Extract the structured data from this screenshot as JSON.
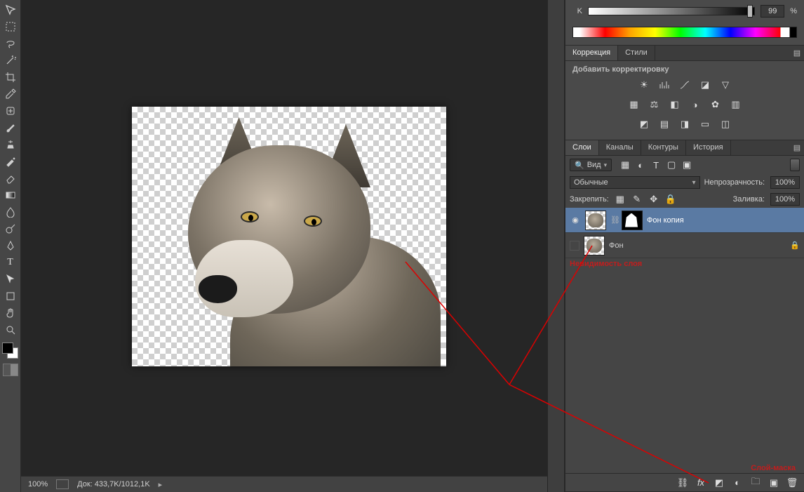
{
  "color_panel": {
    "channel_label": "K",
    "value": "99",
    "percent_suffix": "%"
  },
  "corrections": {
    "tab_active": "Коррекция",
    "tab_styles": "Стили",
    "subheading": "Добавить корректировку"
  },
  "layers_panel": {
    "tabs": [
      "Слои",
      "Каналы",
      "Контуры",
      "История"
    ],
    "filter_label": "Вид",
    "blend_mode": "Обычные",
    "opacity_label": "Непрозрачность:",
    "opacity_value": "100%",
    "lock_label": "Закрепить:",
    "fill_label": "Заливка:",
    "fill_value": "100%",
    "layers": [
      {
        "name": "Фон копия",
        "visible": true,
        "has_mask": true,
        "selected": true,
        "locked": false
      },
      {
        "name": "Фон",
        "visible": false,
        "has_mask": false,
        "selected": false,
        "locked": true
      }
    ]
  },
  "annotations": {
    "visibility": "Невидимость слоя",
    "layer_mask": "Слой-маска"
  },
  "status_bar": {
    "zoom": "100%",
    "doc_info": "Док: 433,7K/1012,1K"
  },
  "tools": [
    "move",
    "marquee",
    "lasso",
    "magic-wand",
    "crop",
    "eyedropper",
    "healing-brush",
    "brush",
    "clone-stamp",
    "history-brush",
    "eraser",
    "gradient",
    "blur",
    "dodge",
    "pen",
    "type",
    "path-select",
    "rectangle",
    "hand",
    "zoom"
  ]
}
